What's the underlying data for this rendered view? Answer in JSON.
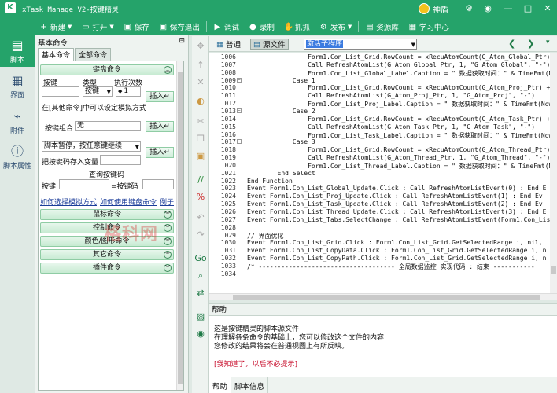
{
  "window": {
    "title": "xTask_Manage_V2-按键精灵",
    "user": "神盾",
    "logo_glyph": "K"
  },
  "toolbar": [
    {
      "label": "新建",
      "icon": "plus-icon",
      "glyph": "+",
      "dropdown": true
    },
    {
      "label": "打开",
      "icon": "folder-icon",
      "glyph": "▭",
      "dropdown": true
    },
    {
      "label": "保存",
      "icon": "save-icon",
      "glyph": "▣",
      "dropdown": false
    },
    {
      "label": "保存退出",
      "icon": "save-exit-icon",
      "glyph": "▣",
      "dropdown": false
    },
    {
      "label": "调试",
      "icon": "play-icon",
      "glyph": "▶",
      "dropdown": false
    },
    {
      "label": "录制",
      "icon": "record-icon",
      "glyph": "●",
      "dropdown": false
    },
    {
      "label": "抓抓",
      "icon": "capture-icon",
      "glyph": "✋",
      "dropdown": false
    },
    {
      "label": "发布",
      "icon": "publish-icon",
      "glyph": "⚙",
      "dropdown": true
    },
    {
      "label": "资源库",
      "icon": "library-icon",
      "glyph": "▤",
      "dropdown": false
    },
    {
      "label": "学习中心",
      "icon": "learn-icon",
      "glyph": "▦",
      "dropdown": false
    }
  ],
  "rail": [
    {
      "label": "脚本",
      "icon": "script-icon",
      "glyph": "▤",
      "active": true
    },
    {
      "label": "界面",
      "icon": "ui-icon",
      "glyph": "▦",
      "active": false
    },
    {
      "label": "附件",
      "icon": "attachment-icon",
      "glyph": "⌁",
      "active": false
    },
    {
      "label": "脚本属性",
      "icon": "info-icon",
      "glyph": "ⓘ",
      "active": false
    }
  ],
  "cmdpanel": {
    "header": "基本命令",
    "tabs": [
      "基本命令",
      "全部命令"
    ],
    "keyboard_group": "键盘命令",
    "key_label": "按键",
    "type_label": "类型",
    "type_value": "按键",
    "count_label": "执行次数",
    "count_value": "1",
    "insert": "插入",
    "use_in_other": "在[其他命令]中可以设定模拟方式",
    "combo_label": "按键组合",
    "combo_value": "无",
    "pause_select": "脚本暂停，按任意键继续",
    "store_label": "把按键码存入变量",
    "query_label": "查询按键码",
    "query_key": "按键",
    "query_code": "=按键码",
    "link_sim": "如何选择模拟方式",
    "link_use": "如何使用键盘命令",
    "link_example": "例子",
    "groups": [
      "鼠标命令",
      "控制命令",
      "颜色/图形命令",
      "其它命令",
      "插件命令"
    ]
  },
  "editor": {
    "mode_normal": "普通",
    "mode_source": "源文件",
    "sub_select": "激活子程序"
  },
  "code_lines": [
    {
      "n": "1006",
      "t": "                Form1.Con_List_Grid.RowCount = xRecuAtomCount(G_Atom_Global_Ptr) + 1"
    },
    {
      "n": "1007",
      "t": "                Call RefreshAtomList(G_Atom_Global_Ptr, 1, \"G_Atom_Global\", \"-\")"
    },
    {
      "n": "1008",
      "t": "                Form1.Con_List_Global_Label.Caption = \" 数据获取时间：\" & TimeFmt(Now"
    },
    {
      "n": "1009",
      "t": "            Case 1"
    },
    {
      "n": "1010",
      "t": "                Form1.Con_List_Grid.RowCount = xRecuAtomCount(G_Atom_Proj_Ptr) + 1"
    },
    {
      "n": "1011",
      "t": "                Call RefreshAtomList(G_Atom_Proj_Ptr, 1, \"G_Atom_Proj\", \"-\")"
    },
    {
      "n": "1012",
      "t": "                Form1.Con_List_Proj_Label.Caption = \" 数据获取时间：\" & TimeFmt(Now"
    },
    {
      "n": "1013",
      "t": "            Case 2"
    },
    {
      "n": "1014",
      "t": "                Form1.Con_List_Grid.RowCount = xRecuAtomCount(G_Atom_Task_Ptr) + 1"
    },
    {
      "n": "1015",
      "t": "                Call RefreshAtomList(G_Atom_Task_Ptr, 1, \"G_Atom_Task\", \"-\")"
    },
    {
      "n": "1016",
      "t": "                Form1.Con_List_Task_Label.Caption = \" 数据获取时间：\" & TimeFmt(Now"
    },
    {
      "n": "1017",
      "t": "            Case 3"
    },
    {
      "n": "1018",
      "t": "                Form1.Con_List_Grid.RowCount = xRecuAtomCount(G_Atom_Thread_Ptr) + 1"
    },
    {
      "n": "1019",
      "t": "                Call RefreshAtomList(G_Atom_Thread_Ptr, 1, \"G_Atom_Thread\", \"-\")"
    },
    {
      "n": "1020",
      "t": "                Form1.Con_List_Thread_Label.Caption = \" 数据获取时间：\" & TimeFmt(Now"
    },
    {
      "n": "1021",
      "t": "        End Select"
    },
    {
      "n": "1022",
      "t": "End Function"
    },
    {
      "n": "1023",
      "t": "Event Form1.Con_List_Global_Update.Click : Call RefreshAtomListEvent(0) : End E"
    },
    {
      "n": "1024",
      "t": "Event Form1.Con_List_Proj_Update.Click : Call RefreshAtomListEvent(1) : End Ev"
    },
    {
      "n": "1025",
      "t": "Event Form1.Con_List_Task_Update.Click : Call RefreshAtomListEvent(2) : End Ev"
    },
    {
      "n": "1026",
      "t": "Event Form1.Con_List_Thread_Update.Click : Call RefreshAtomListEvent(3) : End E"
    },
    {
      "n": "1027",
      "t": "Event Form1.Con_List_Tabs.SelectChange : Call RefreshAtomListEvent(Form1.Con_Lis"
    },
    {
      "n": "1028",
      "t": ""
    },
    {
      "n": "1029",
      "t": "// 界面优化"
    },
    {
      "n": "1030",
      "t": "Event Form1.Con_List_Grid.Click : Form1.Con_List_Grid.GetSelectedRange i, nil,"
    },
    {
      "n": "1031",
      "t": "Event Form1.Con_List_CopyData.Click : Form1.Con_List_Grid.GetSelectedRange i, n"
    },
    {
      "n": "1032",
      "t": "Event Form1.Con_List_CopyPath.Click : Form1.Con_List_Grid.GetSelectedRange i, n"
    },
    {
      "n": "1033",
      "t": "/* ------------------------------------ 全局数据监控 实现代码 : 结束 -----------"
    },
    {
      "n": "1034",
      "t": ""
    }
  ],
  "help": {
    "title": "帮助",
    "line1": "这是按键精灵的脚本源文件",
    "line2": "在理解各条命令的基础上，您可以修改这个文件的内容",
    "line3": "您修改的结果将会在普通视图上有所反映。",
    "line4": "[我知道了，以后不必提示]",
    "tabs": [
      "帮助",
      "脚本信息"
    ]
  },
  "watermark": "格科网",
  "colors": {
    "brand": "#25a36a",
    "accent_link": "#1c3d9a",
    "warning": "#c8102e"
  }
}
